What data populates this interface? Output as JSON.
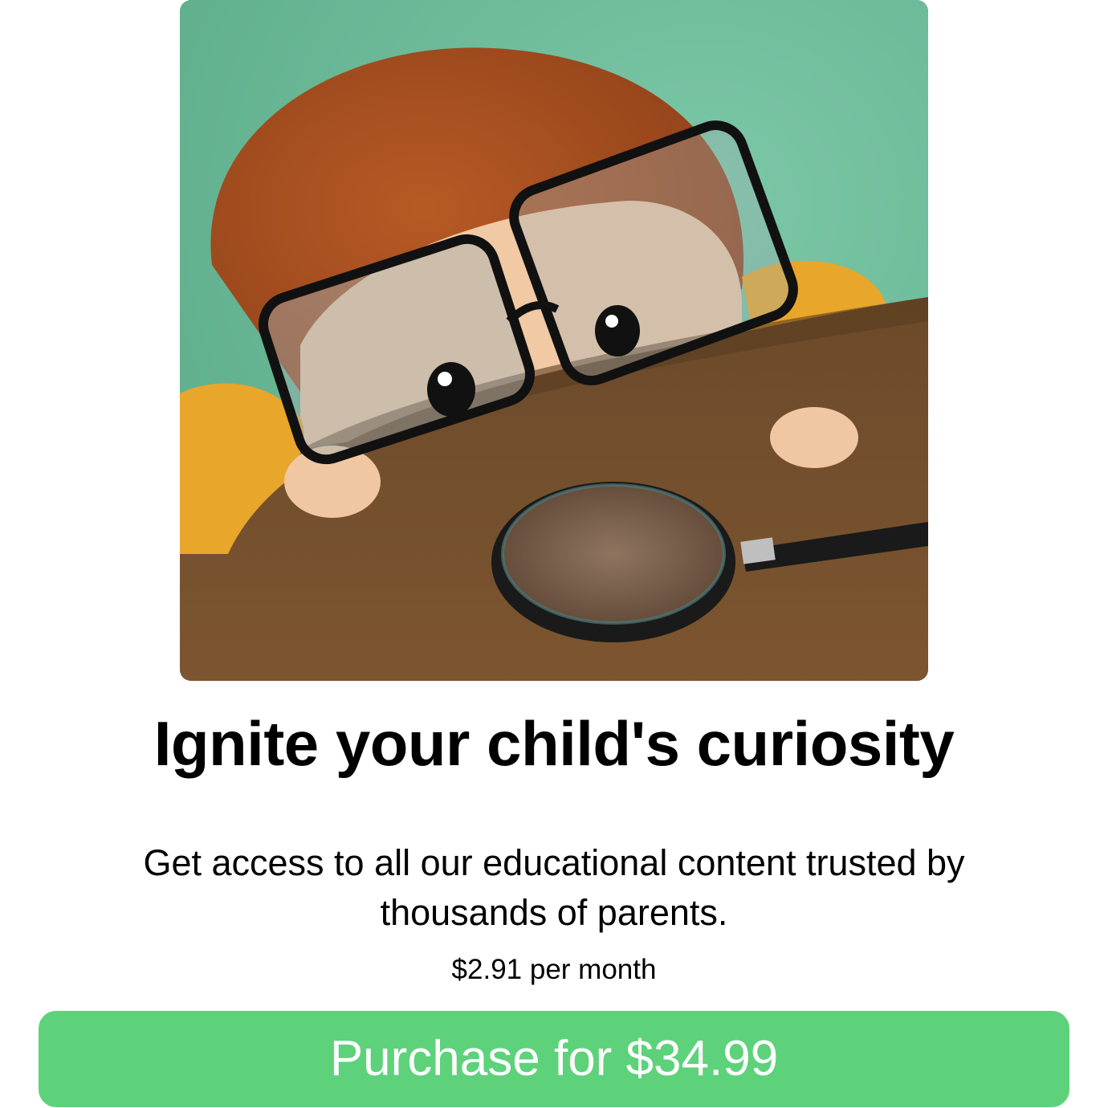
{
  "hero": {
    "illustration": "child-with-glasses-and-magnifying-glass"
  },
  "headline": "Ignite your child's curiosity",
  "subtitle": "Get access to all our educational content trusted by thousands of parents.",
  "price_note": "$2.91 per month",
  "purchase_button": {
    "label": "Purchase for $34.99"
  },
  "colors": {
    "accent": "#5dd27a",
    "hero_background": "#6db89a",
    "text": "#000000",
    "button_text": "#ffffff"
  }
}
